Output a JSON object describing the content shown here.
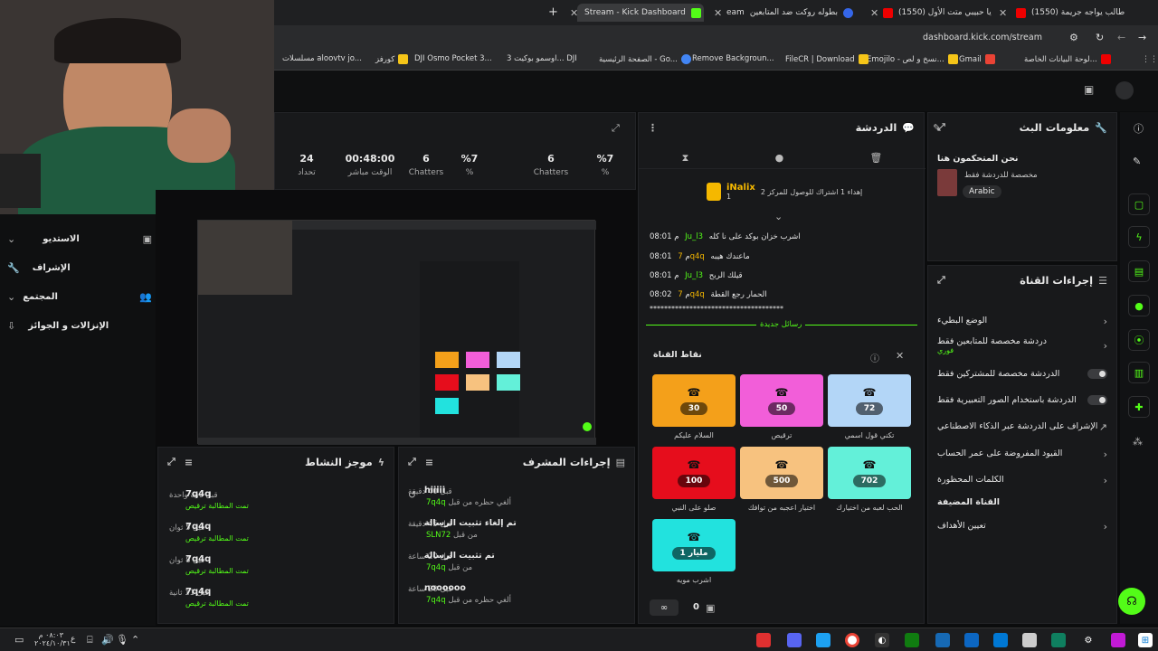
{
  "browser": {
    "tabs": [
      {
        "title": "Stream - Kick Dashboard",
        "active": true
      },
      {
        "title": "بطوله روكت ضد المتابعين",
        "prefix": "eam"
      },
      {
        "title": "(1550) يا حبيبي متت الأول"
      },
      {
        "title": "(1550) قصة طالب يواجه جريمة"
      }
    ],
    "new_tab": "+",
    "url": "dashboard.kick.com/stream",
    "bookmarks": [
      "لوحة البيانات الخاصة...",
      "Gmail",
      "Emojilo - نسخ و لص...",
      "FileCR | Download",
      "Remove Backgroun...",
      "الصفحة الرئيسية - Go...",
      "اوسمو بوكيت 3... DJI",
      "DJI Osmo Pocket 3...",
      "كورفز",
      "مسلسلات aloovtv jo..."
    ]
  },
  "stats": [
    {
      "value": "%7",
      "label": "%"
    },
    {
      "value": "6",
      "label": "Chatters"
    },
    {
      "value": "%7",
      "label": "%"
    },
    {
      "value": "6",
      "label": "Chatters"
    },
    {
      "value": "00:48:00",
      "label": "الوقت مباشر"
    },
    {
      "value": "24",
      "label": "تحداد"
    }
  ],
  "left_nav": [
    {
      "label": "الاستديو"
    },
    {
      "label": "الإشراف"
    },
    {
      "label": "المجتمع"
    },
    {
      "label": "الإنزالات و الجوائز"
    }
  ],
  "chat": {
    "title": "الدردشة",
    "pinned_user": "iNalix",
    "pinned_count": "1",
    "pinned_text": "إهداء 1 اشتراك للوصول للمركز 2",
    "messages": [
      {
        "time": "08:01 م",
        "user": "Ju_l3",
        "text": "اشرب خزان بوكد على نا كله"
      },
      {
        "time": "08:01 م",
        "user": "7q4q",
        "text": "ماعندك هيبه"
      },
      {
        "time": "08:01 م",
        "user": "Ju_l3",
        "text": "قيلك الربح"
      },
      {
        "time": "08:02 م",
        "user": "7q4q",
        "text": "الحمار رجع القطة"
      }
    ],
    "stars": "*************************************",
    "new_messages": "رسائل جديدة",
    "points_title": "نقاط القناة",
    "rewards": [
      {
        "cost": "72",
        "name": "تكني قول اسمي",
        "color": "#b3d6f7"
      },
      {
        "cost": "50",
        "name": "ترقيص",
        "color": "#f25ed9"
      },
      {
        "cost": "30",
        "name": "السلام عليكم",
        "color": "#f4a01a"
      },
      {
        "cost": "702",
        "name": "الحب لعبه من اختيارك",
        "color": "#63f0d9"
      },
      {
        "cost": "500",
        "name": "اختيار اعجبه من توافك",
        "color": "#f7c27f"
      },
      {
        "cost": "100",
        "name": "صلو على النبي",
        "color": "#e60d1c"
      },
      {
        "cost": "مليار 1",
        "name": "اشرب مويه",
        "color": "#22e2de"
      }
    ],
    "footer_points": "0"
  },
  "stream_info": {
    "title": "معلومات البث",
    "stream_title": "نحن المتحكمون هنا",
    "category": "مخصصة للدردشة فقط",
    "tag": "Arabic"
  },
  "channel_actions": {
    "title": "إجراءات القناة",
    "items": [
      {
        "label": "الوضع البطيء",
        "type": "chevron"
      },
      {
        "label": "دردشة مخصصة للمتابعين فقط",
        "sub": "فوري",
        "type": "chevron"
      },
      {
        "label": "الدردشة مخصصة للمشتركين فقط",
        "type": "switch"
      },
      {
        "label": "الدردشة باستخدام الصور التعبيرية فقط",
        "type": "switch"
      },
      {
        "label": "الإشراف على الدردشة عبر الذكاء الاصطناعي",
        "type": "link"
      },
      {
        "label": "القيود المفروضة على عمر الحساب",
        "type": "chevron"
      },
      {
        "label": "الكلمات المحظورة",
        "type": "chevron"
      },
      {
        "label": "القناة المضيفة",
        "type": "none"
      },
      {
        "label": "تعيين الأهداف",
        "type": "chevron"
      }
    ]
  },
  "mod_actions": {
    "title": "إجراءات المشرف",
    "items": [
      {
        "title": "hiiiii",
        "desc": "ألغي حظره من قبل",
        "user": "7q4q",
        "time": "قبل 40 دقيقة"
      },
      {
        "title": "تم إلغاء تثبيت الرسالة",
        "desc": "من قبل",
        "user": "SLN72",
        "time": "قبل 45 دقيقة"
      },
      {
        "title": "تم تثبيت الرسالة",
        "desc": "من قبل",
        "user": "7q4q",
        "time": "قبل 20 ساعة"
      },
      {
        "title": "noooooo",
        "desc": "ألغي حظره من قبل",
        "user": "7q4q",
        "time": "قبل 20 ساعة"
      }
    ]
  },
  "activity": {
    "title": "موجز النشاط",
    "items": [
      {
        "user": "7q4q",
        "desc": "تمت المطالبة ترقيص",
        "time": "قبل ثانية واحدة"
      },
      {
        "user": "7q4q",
        "desc": "تمت المطالبة ترقيص",
        "time": "قبل 5 ثوان"
      },
      {
        "user": "7q4q",
        "desc": "تمت المطالبة ترقيص",
        "time": "قبل 8 ثوان"
      },
      {
        "user": "7q4q",
        "desc": "تمت المطالبة ترقيص",
        "time": "قبل 11 ثانية"
      }
    ]
  },
  "taskbar": {
    "time": "٠٨:٠٣ م",
    "date": "٢٠٢٤/١٠/٣١",
    "lang": "ع"
  },
  "colors": {
    "accent": "#53fc18",
    "panel": "#18191b"
  }
}
